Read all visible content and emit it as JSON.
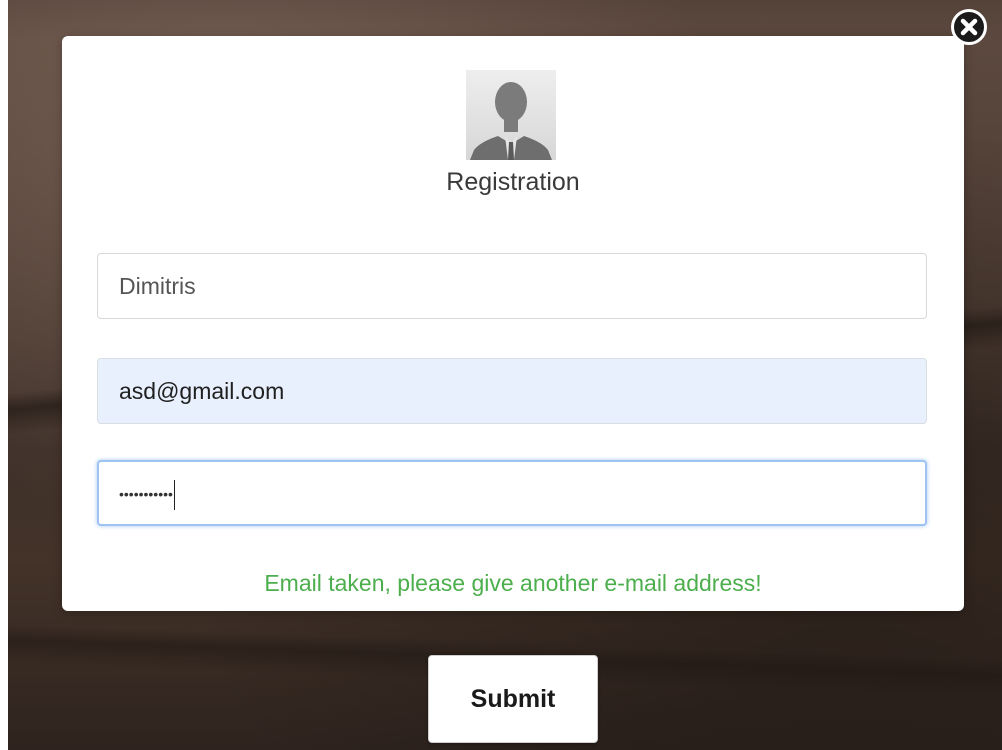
{
  "dialog": {
    "title": "Registration",
    "avatar_icon": "user-silhouette-icon",
    "close_icon": "close-icon",
    "fields": {
      "name": {
        "value": "Dimitris"
      },
      "email": {
        "value": "asd@gmail.com",
        "autofilled": true
      },
      "password": {
        "masked_value": "•••••••••••",
        "focused": true
      }
    },
    "message": "Email taken, please give another e-mail address!",
    "message_color": "#4cae4c",
    "focus_color": "#9ec3f2",
    "autofill_color": "#e8f0fe"
  },
  "submit_label": "Submit"
}
